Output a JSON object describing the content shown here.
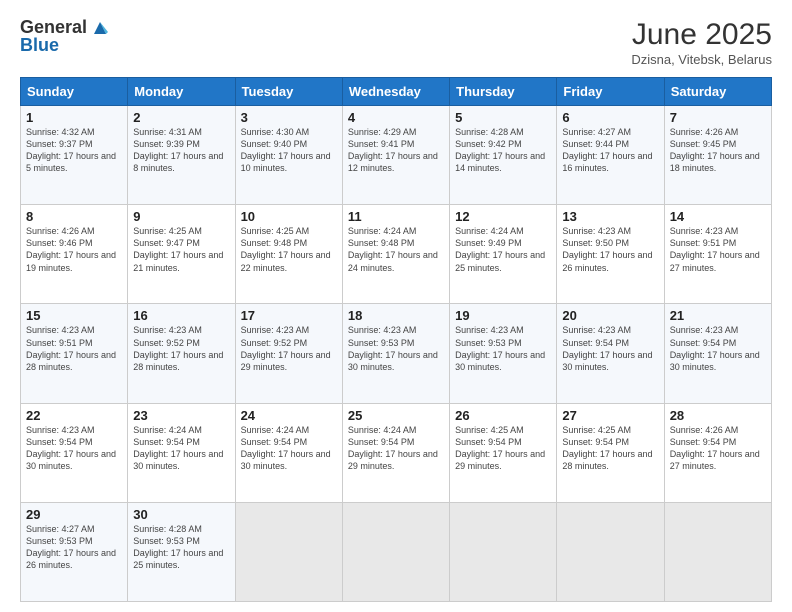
{
  "header": {
    "logo_general": "General",
    "logo_blue": "Blue",
    "month": "June 2025",
    "location": "Dzisna, Vitebsk, Belarus"
  },
  "days_of_week": [
    "Sunday",
    "Monday",
    "Tuesday",
    "Wednesday",
    "Thursday",
    "Friday",
    "Saturday"
  ],
  "weeks": [
    [
      {
        "day": "1",
        "sunrise": "4:32 AM",
        "sunset": "9:37 PM",
        "daylight": "17 hours and 5 minutes."
      },
      {
        "day": "2",
        "sunrise": "4:31 AM",
        "sunset": "9:39 PM",
        "daylight": "17 hours and 8 minutes."
      },
      {
        "day": "3",
        "sunrise": "4:30 AM",
        "sunset": "9:40 PM",
        "daylight": "17 hours and 10 minutes."
      },
      {
        "day": "4",
        "sunrise": "4:29 AM",
        "sunset": "9:41 PM",
        "daylight": "17 hours and 12 minutes."
      },
      {
        "day": "5",
        "sunrise": "4:28 AM",
        "sunset": "9:42 PM",
        "daylight": "17 hours and 14 minutes."
      },
      {
        "day": "6",
        "sunrise": "4:27 AM",
        "sunset": "9:44 PM",
        "daylight": "17 hours and 16 minutes."
      },
      {
        "day": "7",
        "sunrise": "4:26 AM",
        "sunset": "9:45 PM",
        "daylight": "17 hours and 18 minutes."
      }
    ],
    [
      {
        "day": "8",
        "sunrise": "4:26 AM",
        "sunset": "9:46 PM",
        "daylight": "17 hours and 19 minutes."
      },
      {
        "day": "9",
        "sunrise": "4:25 AM",
        "sunset": "9:47 PM",
        "daylight": "17 hours and 21 minutes."
      },
      {
        "day": "10",
        "sunrise": "4:25 AM",
        "sunset": "9:48 PM",
        "daylight": "17 hours and 22 minutes."
      },
      {
        "day": "11",
        "sunrise": "4:24 AM",
        "sunset": "9:48 PM",
        "daylight": "17 hours and 24 minutes."
      },
      {
        "day": "12",
        "sunrise": "4:24 AM",
        "sunset": "9:49 PM",
        "daylight": "17 hours and 25 minutes."
      },
      {
        "day": "13",
        "sunrise": "4:23 AM",
        "sunset": "9:50 PM",
        "daylight": "17 hours and 26 minutes."
      },
      {
        "day": "14",
        "sunrise": "4:23 AM",
        "sunset": "9:51 PM",
        "daylight": "17 hours and 27 minutes."
      }
    ],
    [
      {
        "day": "15",
        "sunrise": "4:23 AM",
        "sunset": "9:51 PM",
        "daylight": "17 hours and 28 minutes."
      },
      {
        "day": "16",
        "sunrise": "4:23 AM",
        "sunset": "9:52 PM",
        "daylight": "17 hours and 28 minutes."
      },
      {
        "day": "17",
        "sunrise": "4:23 AM",
        "sunset": "9:52 PM",
        "daylight": "17 hours and 29 minutes."
      },
      {
        "day": "18",
        "sunrise": "4:23 AM",
        "sunset": "9:53 PM",
        "daylight": "17 hours and 30 minutes."
      },
      {
        "day": "19",
        "sunrise": "4:23 AM",
        "sunset": "9:53 PM",
        "daylight": "17 hours and 30 minutes."
      },
      {
        "day": "20",
        "sunrise": "4:23 AM",
        "sunset": "9:54 PM",
        "daylight": "17 hours and 30 minutes."
      },
      {
        "day": "21",
        "sunrise": "4:23 AM",
        "sunset": "9:54 PM",
        "daylight": "17 hours and 30 minutes."
      }
    ],
    [
      {
        "day": "22",
        "sunrise": "4:23 AM",
        "sunset": "9:54 PM",
        "daylight": "17 hours and 30 minutes."
      },
      {
        "day": "23",
        "sunrise": "4:24 AM",
        "sunset": "9:54 PM",
        "daylight": "17 hours and 30 minutes."
      },
      {
        "day": "24",
        "sunrise": "4:24 AM",
        "sunset": "9:54 PM",
        "daylight": "17 hours and 30 minutes."
      },
      {
        "day": "25",
        "sunrise": "4:24 AM",
        "sunset": "9:54 PM",
        "daylight": "17 hours and 29 minutes."
      },
      {
        "day": "26",
        "sunrise": "4:25 AM",
        "sunset": "9:54 PM",
        "daylight": "17 hours and 29 minutes."
      },
      {
        "day": "27",
        "sunrise": "4:25 AM",
        "sunset": "9:54 PM",
        "daylight": "17 hours and 28 minutes."
      },
      {
        "day": "28",
        "sunrise": "4:26 AM",
        "sunset": "9:54 PM",
        "daylight": "17 hours and 27 minutes."
      }
    ],
    [
      {
        "day": "29",
        "sunrise": "4:27 AM",
        "sunset": "9:53 PM",
        "daylight": "17 hours and 26 minutes."
      },
      {
        "day": "30",
        "sunrise": "4:28 AM",
        "sunset": "9:53 PM",
        "daylight": "17 hours and 25 minutes."
      },
      null,
      null,
      null,
      null,
      null
    ]
  ]
}
